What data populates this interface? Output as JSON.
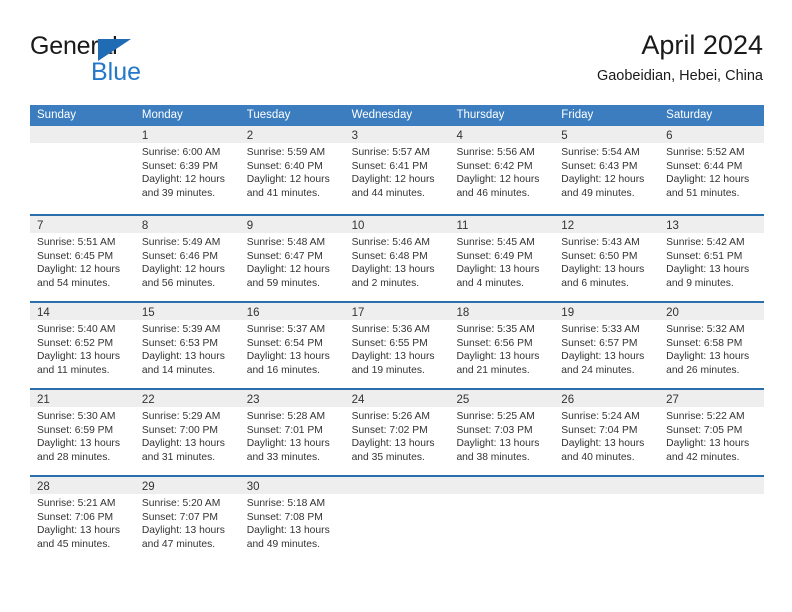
{
  "brand": {
    "word_one": "General",
    "word_two": "Blue",
    "accent_color": "#2478c8"
  },
  "header": {
    "title": "April 2024",
    "location": "Gaobeidian, Hebei, China"
  },
  "theme": {
    "header_bg": "#3b7dbf",
    "row_divider": "#2a6ead",
    "day_band_bg": "#eeeeee",
    "text": "#333333"
  },
  "weekdays": [
    "Sunday",
    "Monday",
    "Tuesday",
    "Wednesday",
    "Thursday",
    "Friday",
    "Saturday"
  ],
  "weeks": [
    [
      {
        "day": "",
        "sunrise": "",
        "sunset": "",
        "daylight_line1": "",
        "daylight_line2": "",
        "empty": true
      },
      {
        "day": "1",
        "sunrise": "Sunrise: 6:00 AM",
        "sunset": "Sunset: 6:39 PM",
        "daylight_line1": "Daylight: 12 hours",
        "daylight_line2": "and 39 minutes."
      },
      {
        "day": "2",
        "sunrise": "Sunrise: 5:59 AM",
        "sunset": "Sunset: 6:40 PM",
        "daylight_line1": "Daylight: 12 hours",
        "daylight_line2": "and 41 minutes."
      },
      {
        "day": "3",
        "sunrise": "Sunrise: 5:57 AM",
        "sunset": "Sunset: 6:41 PM",
        "daylight_line1": "Daylight: 12 hours",
        "daylight_line2": "and 44 minutes."
      },
      {
        "day": "4",
        "sunrise": "Sunrise: 5:56 AM",
        "sunset": "Sunset: 6:42 PM",
        "daylight_line1": "Daylight: 12 hours",
        "daylight_line2": "and 46 minutes."
      },
      {
        "day": "5",
        "sunrise": "Sunrise: 5:54 AM",
        "sunset": "Sunset: 6:43 PM",
        "daylight_line1": "Daylight: 12 hours",
        "daylight_line2": "and 49 minutes."
      },
      {
        "day": "6",
        "sunrise": "Sunrise: 5:52 AM",
        "sunset": "Sunset: 6:44 PM",
        "daylight_line1": "Daylight: 12 hours",
        "daylight_line2": "and 51 minutes."
      }
    ],
    [
      {
        "day": "7",
        "sunrise": "Sunrise: 5:51 AM",
        "sunset": "Sunset: 6:45 PM",
        "daylight_line1": "Daylight: 12 hours",
        "daylight_line2": "and 54 minutes."
      },
      {
        "day": "8",
        "sunrise": "Sunrise: 5:49 AM",
        "sunset": "Sunset: 6:46 PM",
        "daylight_line1": "Daylight: 12 hours",
        "daylight_line2": "and 56 minutes."
      },
      {
        "day": "9",
        "sunrise": "Sunrise: 5:48 AM",
        "sunset": "Sunset: 6:47 PM",
        "daylight_line1": "Daylight: 12 hours",
        "daylight_line2": "and 59 minutes."
      },
      {
        "day": "10",
        "sunrise": "Sunrise: 5:46 AM",
        "sunset": "Sunset: 6:48 PM",
        "daylight_line1": "Daylight: 13 hours",
        "daylight_line2": "and 2 minutes."
      },
      {
        "day": "11",
        "sunrise": "Sunrise: 5:45 AM",
        "sunset": "Sunset: 6:49 PM",
        "daylight_line1": "Daylight: 13 hours",
        "daylight_line2": "and 4 minutes."
      },
      {
        "day": "12",
        "sunrise": "Sunrise: 5:43 AM",
        "sunset": "Sunset: 6:50 PM",
        "daylight_line1": "Daylight: 13 hours",
        "daylight_line2": "and 6 minutes."
      },
      {
        "day": "13",
        "sunrise": "Sunrise: 5:42 AM",
        "sunset": "Sunset: 6:51 PM",
        "daylight_line1": "Daylight: 13 hours",
        "daylight_line2": "and 9 minutes."
      }
    ],
    [
      {
        "day": "14",
        "sunrise": "Sunrise: 5:40 AM",
        "sunset": "Sunset: 6:52 PM",
        "daylight_line1": "Daylight: 13 hours",
        "daylight_line2": "and 11 minutes."
      },
      {
        "day": "15",
        "sunrise": "Sunrise: 5:39 AM",
        "sunset": "Sunset: 6:53 PM",
        "daylight_line1": "Daylight: 13 hours",
        "daylight_line2": "and 14 minutes."
      },
      {
        "day": "16",
        "sunrise": "Sunrise: 5:37 AM",
        "sunset": "Sunset: 6:54 PM",
        "daylight_line1": "Daylight: 13 hours",
        "daylight_line2": "and 16 minutes."
      },
      {
        "day": "17",
        "sunrise": "Sunrise: 5:36 AM",
        "sunset": "Sunset: 6:55 PM",
        "daylight_line1": "Daylight: 13 hours",
        "daylight_line2": "and 19 minutes."
      },
      {
        "day": "18",
        "sunrise": "Sunrise: 5:35 AM",
        "sunset": "Sunset: 6:56 PM",
        "daylight_line1": "Daylight: 13 hours",
        "daylight_line2": "and 21 minutes."
      },
      {
        "day": "19",
        "sunrise": "Sunrise: 5:33 AM",
        "sunset": "Sunset: 6:57 PM",
        "daylight_line1": "Daylight: 13 hours",
        "daylight_line2": "and 24 minutes."
      },
      {
        "day": "20",
        "sunrise": "Sunrise: 5:32 AM",
        "sunset": "Sunset: 6:58 PM",
        "daylight_line1": "Daylight: 13 hours",
        "daylight_line2": "and 26 minutes."
      }
    ],
    [
      {
        "day": "21",
        "sunrise": "Sunrise: 5:30 AM",
        "sunset": "Sunset: 6:59 PM",
        "daylight_line1": "Daylight: 13 hours",
        "daylight_line2": "and 28 minutes."
      },
      {
        "day": "22",
        "sunrise": "Sunrise: 5:29 AM",
        "sunset": "Sunset: 7:00 PM",
        "daylight_line1": "Daylight: 13 hours",
        "daylight_line2": "and 31 minutes."
      },
      {
        "day": "23",
        "sunrise": "Sunrise: 5:28 AM",
        "sunset": "Sunset: 7:01 PM",
        "daylight_line1": "Daylight: 13 hours",
        "daylight_line2": "and 33 minutes."
      },
      {
        "day": "24",
        "sunrise": "Sunrise: 5:26 AM",
        "sunset": "Sunset: 7:02 PM",
        "daylight_line1": "Daylight: 13 hours",
        "daylight_line2": "and 35 minutes."
      },
      {
        "day": "25",
        "sunrise": "Sunrise: 5:25 AM",
        "sunset": "Sunset: 7:03 PM",
        "daylight_line1": "Daylight: 13 hours",
        "daylight_line2": "and 38 minutes."
      },
      {
        "day": "26",
        "sunrise": "Sunrise: 5:24 AM",
        "sunset": "Sunset: 7:04 PM",
        "daylight_line1": "Daylight: 13 hours",
        "daylight_line2": "and 40 minutes."
      },
      {
        "day": "27",
        "sunrise": "Sunrise: 5:22 AM",
        "sunset": "Sunset: 7:05 PM",
        "daylight_line1": "Daylight: 13 hours",
        "daylight_line2": "and 42 minutes."
      }
    ],
    [
      {
        "day": "28",
        "sunrise": "Sunrise: 5:21 AM",
        "sunset": "Sunset: 7:06 PM",
        "daylight_line1": "Daylight: 13 hours",
        "daylight_line2": "and 45 minutes."
      },
      {
        "day": "29",
        "sunrise": "Sunrise: 5:20 AM",
        "sunset": "Sunset: 7:07 PM",
        "daylight_line1": "Daylight: 13 hours",
        "daylight_line2": "and 47 minutes."
      },
      {
        "day": "30",
        "sunrise": "Sunrise: 5:18 AM",
        "sunset": "Sunset: 7:08 PM",
        "daylight_line1": "Daylight: 13 hours",
        "daylight_line2": "and 49 minutes."
      },
      {
        "day": "",
        "sunrise": "",
        "sunset": "",
        "daylight_line1": "",
        "daylight_line2": "",
        "empty": true
      },
      {
        "day": "",
        "sunrise": "",
        "sunset": "",
        "daylight_line1": "",
        "daylight_line2": "",
        "empty": true
      },
      {
        "day": "",
        "sunrise": "",
        "sunset": "",
        "daylight_line1": "",
        "daylight_line2": "",
        "empty": true
      },
      {
        "day": "",
        "sunrise": "",
        "sunset": "",
        "daylight_line1": "",
        "daylight_line2": "",
        "empty": true
      }
    ]
  ]
}
